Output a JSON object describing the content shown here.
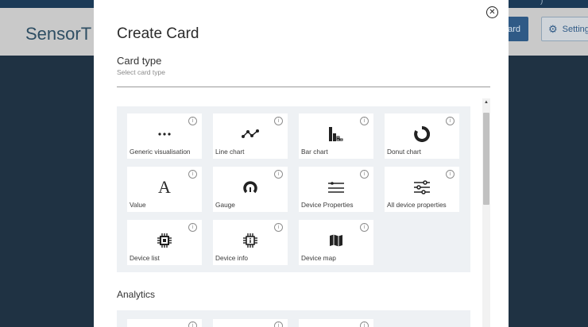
{
  "app": {
    "brand": "SensorT",
    "create_button": "ard",
    "settings_button": "Setting",
    "topbar_text": ")"
  },
  "modal": {
    "title": "Create Card",
    "close_glyph": "✕",
    "card_type": {
      "label": "Card type",
      "placeholder": "Select card type"
    },
    "tiles": [
      {
        "label": "Generic visualisation",
        "icon": "more-dots-icon"
      },
      {
        "label": "Line chart",
        "icon": "line-chart-icon"
      },
      {
        "label": "Bar chart",
        "icon": "bar-chart-icon"
      },
      {
        "label": "Donut chart",
        "icon": "donut-chart-icon"
      },
      {
        "label": "Value",
        "icon": "value-icon"
      },
      {
        "label": "Gauge",
        "icon": "gauge-icon"
      },
      {
        "label": "Device Properties",
        "icon": "properties-list-icon"
      },
      {
        "label": "All device properties",
        "icon": "sliders-icon"
      },
      {
        "label": "Device list",
        "icon": "chip-icon"
      },
      {
        "label": "Device info",
        "icon": "chip-info-icon"
      },
      {
        "label": "Device map",
        "icon": "map-icon"
      }
    ],
    "info_glyph": "i",
    "value_glyph": "A",
    "analytics": {
      "title": "Analytics"
    }
  }
}
